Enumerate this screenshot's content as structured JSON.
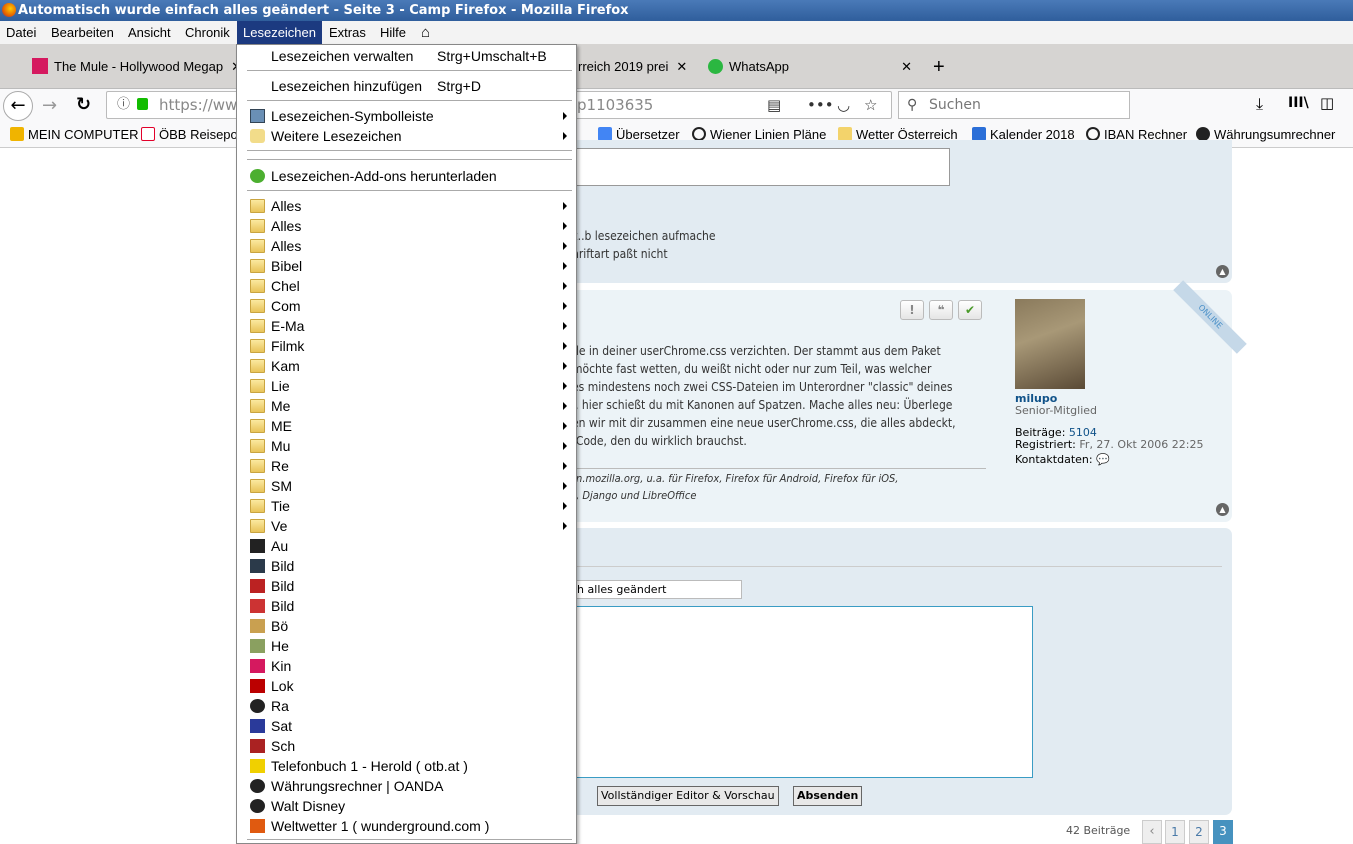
{
  "window": {
    "title": "Automatisch wurde einfach alles geändert - Seite 3 - Camp Firefox - Mozilla Firefox"
  },
  "menubar": [
    "Datei",
    "Bearbeiten",
    "Ansicht",
    "Chronik",
    "Lesezeichen",
    "Extras",
    "Hilfe"
  ],
  "tabs": [
    {
      "label": "The Mule - Hollywood Megap"
    },
    {
      "label": "rreich 2019 prei"
    },
    {
      "label": "WhatsApp"
    }
  ],
  "nav": {
    "url_start": "https://www",
    "url_end": "p1103635",
    "search_placeholder": "Suchen"
  },
  "bookmarks_bar": [
    "MEIN COMPUTER",
    "ÖBB Reisepor",
    "Übersetzer",
    "Wiener Linien Pläne",
    "Wetter Österreich",
    "Kalender 2018",
    "IBAN Rechner",
    "Währungsumrechner"
  ],
  "bookmarks_menu": {
    "manage": {
      "label": "Lesezeichen verwalten",
      "shortcut": "Strg+Umschalt+B"
    },
    "add": {
      "label": "Lesezeichen hinzufügen",
      "shortcut": "Strg+D"
    },
    "toolbar": "Lesezeichen-Symbolleiste",
    "other": "Weitere Lesezeichen",
    "addons": "Lesezeichen-Add-ons herunterladen",
    "folders": [
      "Alles",
      "Alles",
      "Alles",
      "Bibel",
      "Chel",
      "Com",
      "E-Ma",
      "Filmk",
      "Kam",
      "Lie",
      "Me",
      "ME",
      "Mu",
      "Re",
      "SM",
      "Tie",
      "Ve"
    ],
    "links": [
      "Au",
      "Bild",
      "Bild",
      "Bild",
      "Bö",
      "He",
      "Kin",
      "Lok",
      "Ra",
      "Sat",
      "Sch",
      "Telefonbuch 1 - Herold ( otb.at )",
      "Währungsrechner | OANDA",
      "Walt Disney",
      "Weltwetter 1 ( wunderground.com )"
    ]
  },
  "post1": {
    "lines": [
      "z..b lesezeichen aufmache",
      "hriftart paßt nicht"
    ]
  },
  "post2": {
    "lines": [
      "de in deiner userChrome.css verzichten. Der stammt aus dem Paket",
      "möchte fast wetten, du weißt nicht oder nur zum Teil, was welcher",
      "es mindestens noch zwei CSS-Dateien im Unterordner \"classic\" deines",
      "l, hier schießt du mit Kanonen auf Spatzen. Mache alles neu: Überlege",
      "en wir mit dir zusammen eine neue userChrome.css, die alles abdeckt,",
      "-Code, den du wirklich brauchst."
    ],
    "signature": [
      "on.mozilla.org, u.a. für Firefox, Firefox für Android, Firefox für iOS,",
      "e, Django und LibreOffice"
    ],
    "author": {
      "name": "milupo",
      "rank": "Senior-Mitglied",
      "posts_label": "Beiträge:",
      "posts": "5104",
      "registered_label": "Registriert:",
      "registered": "Fr, 27. Okt 2006 22:25",
      "contact_label": "Kontaktdaten:",
      "online": "ONLINE"
    }
  },
  "reply": {
    "subject": "ch alles geändert",
    "full_editor": "Vollständiger Editor & Vorschau",
    "submit": "Absenden"
  },
  "pagination": {
    "count": "42 Beiträge",
    "pages": [
      "1",
      "2",
      "3"
    ],
    "current": "3"
  }
}
